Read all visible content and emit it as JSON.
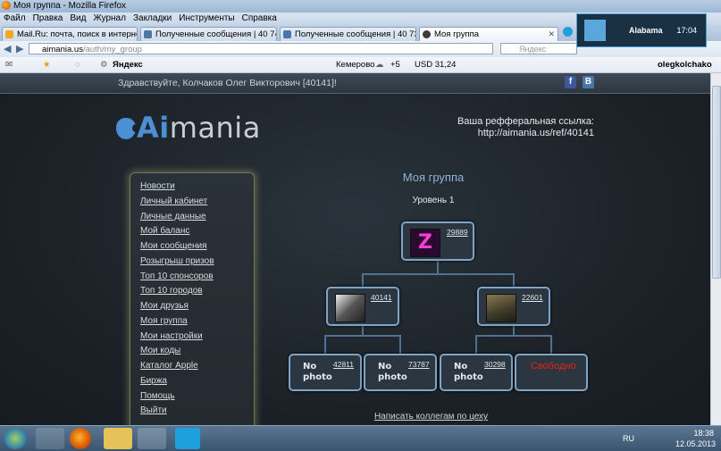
{
  "window": {
    "title": "Моя группа - Mozilla Firefox"
  },
  "menu": [
    "Файл",
    "Правка",
    "Вид",
    "Журнал",
    "Закладки",
    "Инструменты",
    "Справка"
  ],
  "tabs": [
    {
      "label": "Mail.Ru: почта, поиск в интернете, н...",
      "active": false,
      "color": "#f5a623"
    },
    {
      "label": "Полученные сообщения | 40 740 со...",
      "active": false,
      "color": "#4a76a8"
    },
    {
      "label": "Полученные сообщения | 40 735 со...",
      "active": false,
      "color": "#4a76a8"
    },
    {
      "label": "Моя группа",
      "active": true,
      "color": "#3b3b3b"
    }
  ],
  "address": {
    "host": "aimania.us",
    "path": "/auth/my_group"
  },
  "search": {
    "placeholder": "Яндекс"
  },
  "yandex_bar": {
    "logo": "Яндекс",
    "city": "Кемерово",
    "weather": "+5",
    "currency": "USD 31,24",
    "user": "olegkolchako"
  },
  "notification": {
    "name": "Alabama",
    "time": "17:04"
  },
  "page": {
    "greeting": "Здравствуйте, Колчаков Олег Викторович [40141]!",
    "social": [
      "f",
      "B"
    ],
    "logo": {
      "ai": "Ai",
      "rest": "mania"
    },
    "referral_label": "Ваша рефферальная ссылка:",
    "referral_url": "http://aimania.us/ref/40141",
    "menu": [
      "Новости",
      "Личный кабинет",
      "Личные данные",
      "Мой баланс",
      "Мои сообщения",
      "Розыгрыш призов",
      "Топ 10 спонсоров",
      "Топ 10 городов",
      "Мои друзья",
      "Моя группа",
      "Мои настройки",
      "Мои коды",
      "Каталог Apple",
      "Биржа",
      "Помощь",
      "Выйти"
    ],
    "group_title": "Моя группа",
    "level": "Уровень 1",
    "tree": {
      "root": "29889",
      "level2": [
        "40141",
        "22601"
      ],
      "level3": [
        {
          "id": "42811",
          "label": "No photo"
        },
        {
          "id": "73787",
          "label": "No photo"
        },
        {
          "id": "30298",
          "label": "No photo"
        },
        {
          "id": "",
          "label": "Свободно"
        }
      ]
    },
    "bottom_link": "Написать коллегам по цеху"
  },
  "taskbar": {
    "lang": "RU",
    "time": "18:38",
    "date": "12.05.2013"
  }
}
